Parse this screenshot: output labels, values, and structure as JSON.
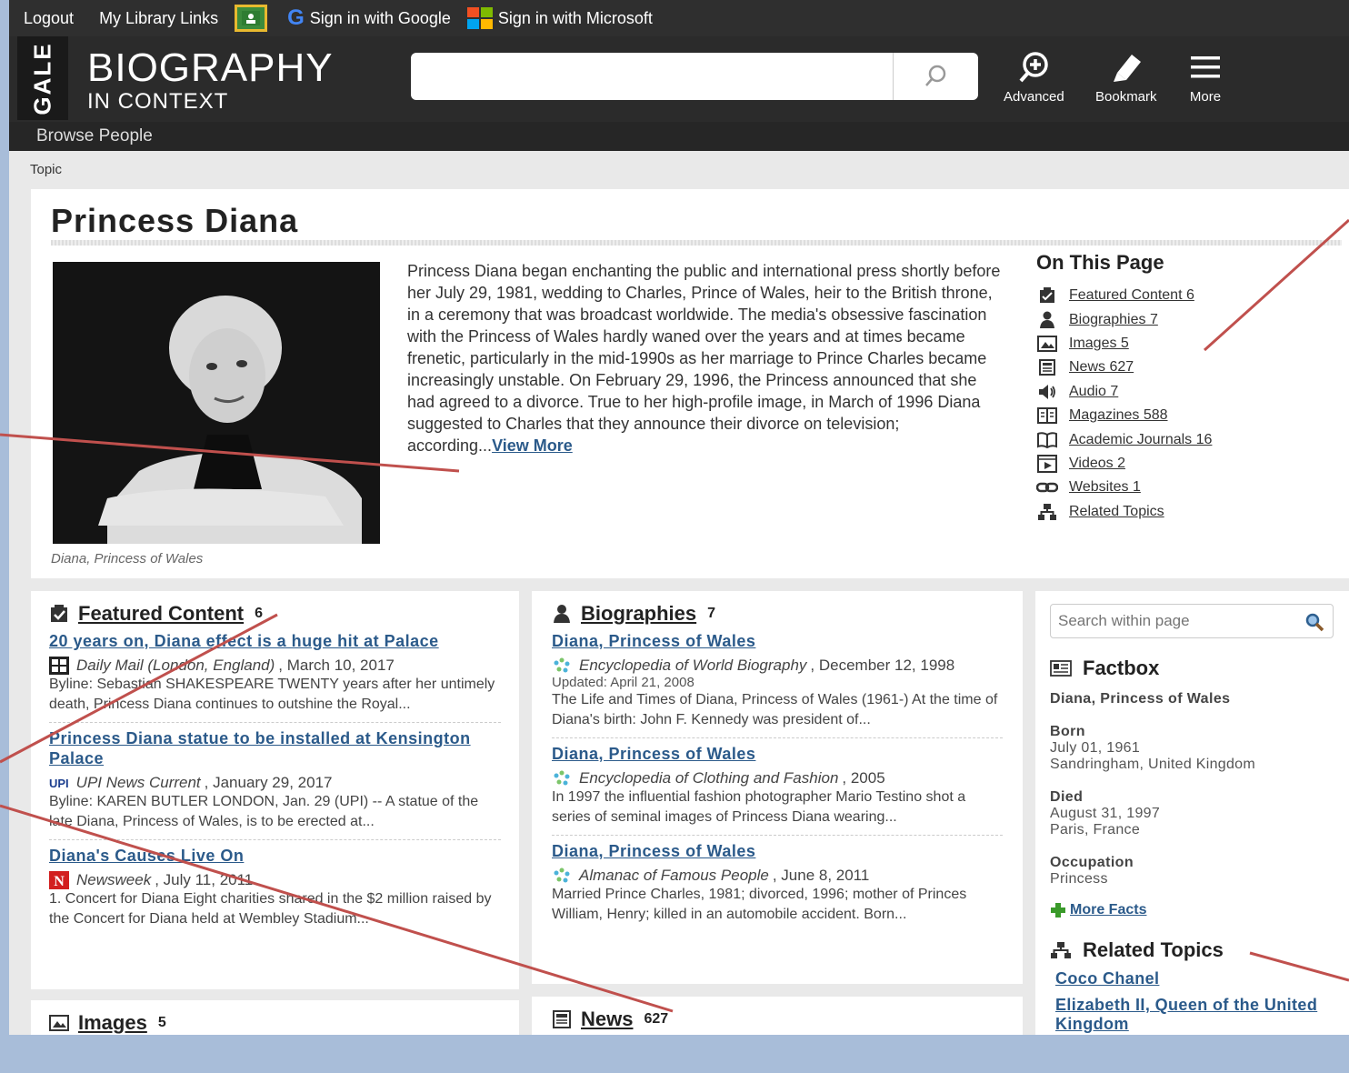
{
  "utilbar": {
    "logout": "Logout",
    "links": "My Library Links",
    "google": "Sign in with Google",
    "microsoft": "Sign in with Microsoft"
  },
  "header": {
    "gale": "GALE",
    "brand_main": "BIOGRAPHY",
    "brand_sub": "IN CONTEXT",
    "search_placeholder": "",
    "advanced": "Advanced",
    "bookmark": "Bookmark",
    "more": "More"
  },
  "browse": "Browse People",
  "breadcrumb": "Topic",
  "topic": {
    "title": "Princess Diana",
    "caption": "Diana, Princess of Wales",
    "summary": "Princess Diana began enchanting the public and international press shortly before her July 29, 1981, wedding to Charles, Prince of Wales, heir to the British throne, in a ceremony that was broadcast worldwide. The media's obsessive fascination with the Princess of Wales hardly waned over the years and at times became frenetic, particularly in the mid-1990s as her marriage to Prince Charles became increasingly unstable. On February 29, 1996, the Princess announced that she had agreed to a divorce. True to her high-profile image, in March of 1996 Diana suggested to Charles that they announce their divorce on television; according...",
    "view_more": "View More"
  },
  "on_this_page": {
    "heading": "On This Page",
    "items": [
      {
        "label": "Featured Content 6",
        "icon": "featured-icon"
      },
      {
        "label": "Biographies 7",
        "icon": "person-icon"
      },
      {
        "label": "Images 5",
        "icon": "image-icon"
      },
      {
        "label": "News 627",
        "icon": "newspaper-icon"
      },
      {
        "label": "Audio 7",
        "icon": "speaker-icon"
      },
      {
        "label": "Magazines 588",
        "icon": "magazine-icon"
      },
      {
        "label": "Academic Journals 16",
        "icon": "book-icon"
      },
      {
        "label": "Videos 2",
        "icon": "video-icon"
      },
      {
        "label": "Websites 1",
        "icon": "link-icon"
      },
      {
        "label": "Related Topics",
        "icon": "hierarchy-icon"
      }
    ]
  },
  "featured": {
    "heading": "Featured Content",
    "count": "6",
    "items": [
      {
        "title": "20 years on, Diana effect is a huge hit at Palace",
        "source": "Daily Mail (London, England)",
        "date": ", March 10, 2017",
        "body": "Byline: Sebastian SHAKESPEARE TWENTY years after her untimely death, Princess Diana continues to outshine the Royal..."
      },
      {
        "title": "Princess Diana statue to be installed at Kensington Palace",
        "source": "UPI News Current",
        "date": ", January 29, 2017",
        "body": "Byline: KAREN BUTLER LONDON, Jan. 29 (UPI) -- A statue of the late Diana, Princess of Wales, is to be erected at..."
      },
      {
        "title": "Diana's Causes Live On",
        "source": "Newsweek",
        "date": ", July 11, 2011",
        "body": "1. Concert for Diana Eight charities shared in the $2 million raised by the Concert for Diana held at Wembley Stadium..."
      }
    ]
  },
  "images_section": {
    "heading": "Images",
    "count": "5"
  },
  "biographies": {
    "heading": "Biographies",
    "count": "7",
    "items": [
      {
        "title": "Diana, Princess of Wales",
        "source": "Encyclopedia of World Biography",
        "date": ", December 12, 1998",
        "updated": "Updated: April 21, 2008",
        "body": "The Life and Times of Diana, Princess of Wales (1961-) At the time of Diana's birth: John F. Kennedy was president of..."
      },
      {
        "title": "Diana, Princess of Wales",
        "source": "Encyclopedia of Clothing and Fashion",
        "date": ", 2005",
        "updated": "",
        "body": "In 1997 the influential fashion photographer Mario Testino shot a series of seminal images of Princess Diana wearing..."
      },
      {
        "title": "Diana, Princess of Wales",
        "source": "Almanac of Famous People",
        "date": ", June 8, 2011",
        "updated": "",
        "body": "Married Prince Charles, 1981; divorced, 1996; mother of Princes William, Henry; killed in an automobile accident. Born..."
      }
    ]
  },
  "news_section": {
    "heading": "News",
    "count": "627"
  },
  "sidebar": {
    "search_placeholder": "Search within page",
    "factbox_heading": "Factbox",
    "name": "Diana, Princess of Wales",
    "born_label": "Born",
    "born_date": "July 01, 1961",
    "born_place": "Sandringham, United Kingdom",
    "died_label": "Died",
    "died_date": "August 31, 1997",
    "died_place": "Paris, France",
    "occupation_label": "Occupation",
    "occupation": "Princess",
    "more_facts": "More Facts",
    "related_heading": "Related Topics",
    "related": [
      "Coco Chanel",
      "Elizabeth II, Queen of the United Kingdom"
    ]
  },
  "colors": {
    "link": "#2b5a8a",
    "header_bg": "#2b2b2b",
    "callout": "#c0504d",
    "frame_bg": "#a8bdd9"
  }
}
